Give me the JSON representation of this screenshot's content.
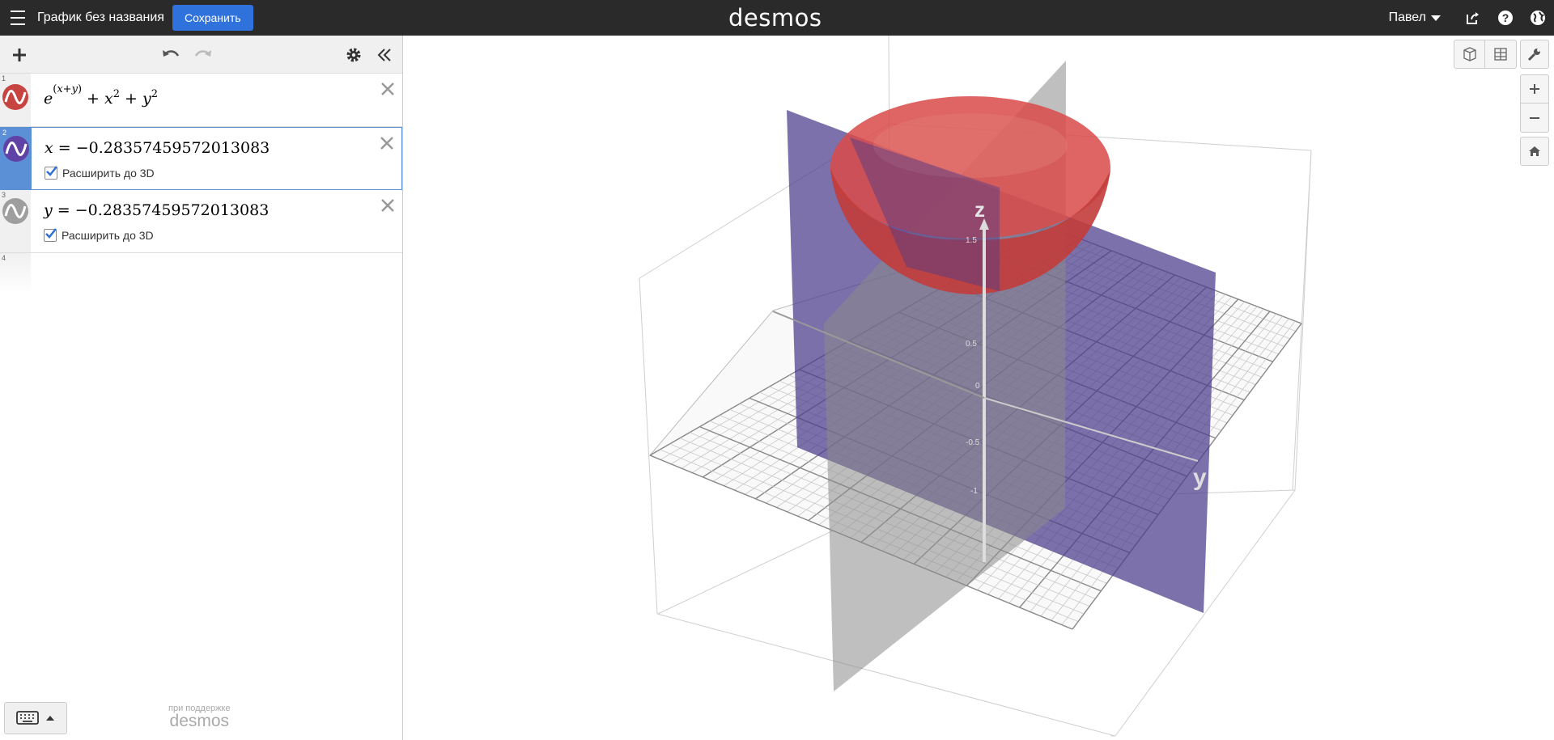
{
  "header": {
    "graph_title": "График без названия",
    "save_label": "Сохранить",
    "logo": "desmos",
    "user_name": "Павел"
  },
  "icons": {
    "menu": "hamburger-icon",
    "share": "share-icon",
    "help": "help-icon",
    "language": "globe-icon",
    "add": "plus-icon",
    "undo": "undo-icon",
    "redo": "redo-icon",
    "settings": "gear-icon",
    "collapse": "double-chevron-left-icon",
    "keyboard": "keyboard-icon",
    "wrench": "wrench-icon",
    "zoom_in": "plus-icon",
    "zoom_out": "minus-icon",
    "home": "home-icon"
  },
  "expressions": [
    {
      "index": "1",
      "color": "#c74440",
      "formula": "e^(x+y) + x^2 + y^2"
    },
    {
      "index": "2",
      "color": "#6042a6",
      "lhs": "x",
      "rhs": "−0.28357459572013083",
      "extend_label": "Расширить до 3D",
      "extend_checked": true,
      "selected": true
    },
    {
      "index": "3",
      "color": "#9e9e9e",
      "lhs": "y",
      "rhs": "−0.28357459572013083",
      "extend_label": "Расширить до 3D",
      "extend_checked": true
    },
    {
      "index": "4"
    }
  ],
  "footer": {
    "powered_small": "при поддержке",
    "powered_brand": "desmos"
  },
  "graph": {
    "z_axis_label": "z",
    "y_axis_label": "y",
    "z_ticks": [
      "1.5",
      "0.5",
      "0",
      "-0.5",
      "-1"
    ],
    "plane_x_color": "#4b3a8c",
    "surface_color": "#d84040"
  }
}
